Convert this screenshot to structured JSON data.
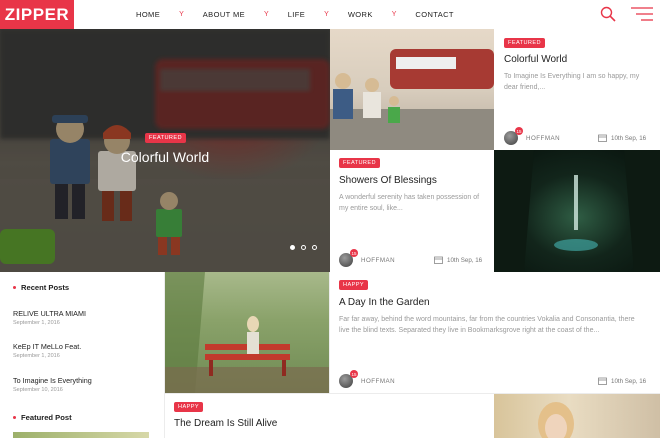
{
  "brand": {
    "logo": "ZIPPER",
    "accent": "#e83548"
  },
  "nav": {
    "items": [
      "HOME",
      "ABOUT ME",
      "LIFE",
      "WORK",
      "CONTACT"
    ],
    "separator": "Y"
  },
  "header_icons": [
    "search-icon",
    "menu-icon"
  ],
  "hero": {
    "badge": "FEATURED",
    "title": "Colorful World",
    "slider_dots": 3,
    "active_slide": 1
  },
  "posts": [
    {
      "badge": "FEATURED",
      "title": "Colorful World",
      "excerpt": "To Imagine Is Everything I am so happy, my dear friend,...",
      "author": "HOFFMAN",
      "avatar_count": "15",
      "date": "10th Sep, 16"
    },
    {
      "badge": "FEATURED",
      "title": "Showers Of Blessings",
      "excerpt": "A wonderful serenity has taken possession of my entire soul, like...",
      "author": "HOFFMAN",
      "avatar_count": "15",
      "date": "10th Sep, 16"
    },
    {
      "badge": "HAPPY",
      "title": "A Day In the Garden",
      "excerpt": "Far far away, behind the word mountains, far from the countries Vokalia and Consonantia, there live the blind texts. Separated they live in Bookmarksgrove right at the coast of the...",
      "author": "HOFFMAN",
      "avatar_count": "15",
      "date": "10th Sep, 16"
    },
    {
      "badge": "HAPPY",
      "title": "The Dream Is Still Alive"
    }
  ],
  "sidebar": {
    "recent_heading": "Recent Posts",
    "recent": [
      {
        "title": "RELIVE ULTRA MIAMI",
        "date": "September 1, 2016"
      },
      {
        "title": "KeEp IT MeLLo Feat.",
        "date": "September 1, 2016"
      },
      {
        "title": "To Imagine Is Everything",
        "date": "September 10, 2016"
      }
    ],
    "featured_heading": "Featured Post"
  }
}
